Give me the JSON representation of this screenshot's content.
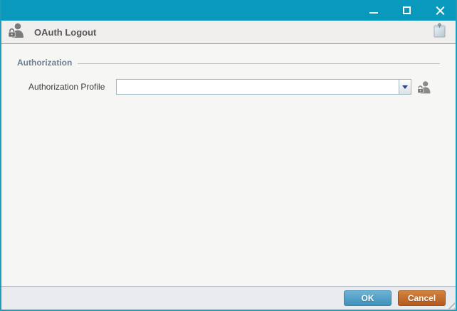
{
  "window": {
    "controls": [
      {
        "name": "minimize"
      },
      {
        "name": "maximize"
      },
      {
        "name": "close"
      }
    ]
  },
  "header": {
    "title": "OAuth Logout",
    "left_icon": "user-lock-icon",
    "right_icon": "note-pin-icon"
  },
  "form": {
    "section_label": "Authorization",
    "fields": [
      {
        "label": "Authorization Profile",
        "value": "",
        "placeholder": "",
        "control": "combobox",
        "picker_icon": "user-lock-icon",
        "dropdown_icon": "chevron-down-icon"
      }
    ]
  },
  "footer": {
    "ok_label": "OK",
    "cancel_label": "Cancel"
  },
  "colors": {
    "titlebar": "#0999bd",
    "window_border": "#1e9cba",
    "header_bg": "#f0efee",
    "body_bg": "#f6f6f5",
    "footer_bg": "#e9ebee",
    "ok_button": "#4796be",
    "cancel_button": "#bb6026",
    "section_label": "#6e7e92"
  }
}
